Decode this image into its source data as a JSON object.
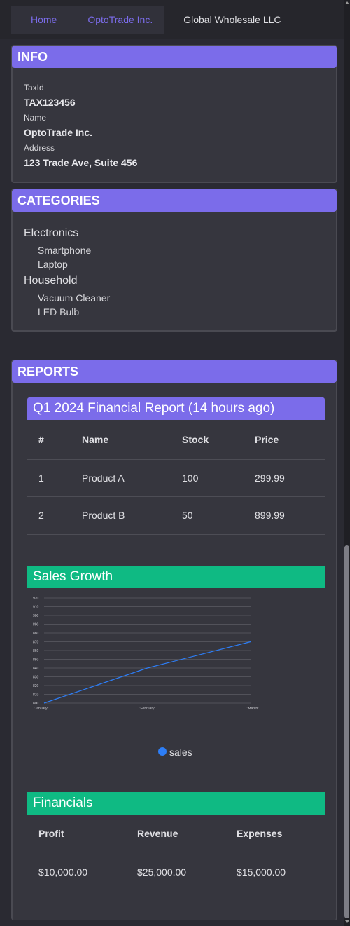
{
  "tabs": [
    "Home",
    "OptoTrade Inc.",
    "Global Wholesale LLC"
  ],
  "info": {
    "title": "INFO",
    "fields": [
      {
        "label": "TaxId",
        "value": "TAX123456"
      },
      {
        "label": "Name",
        "value": "OptoTrade Inc."
      },
      {
        "label": "Address",
        "value": "123 Trade Ave, Suite 456"
      }
    ]
  },
  "categories": {
    "title": "CATEGORIES",
    "groups": [
      {
        "name": "Electronics",
        "items": [
          "Smartphone",
          "Laptop"
        ]
      },
      {
        "name": "Household",
        "items": [
          "Vacuum Cleaner",
          "LED Bulb"
        ]
      }
    ]
  },
  "reports": {
    "title": "REPORTS",
    "financial_report": {
      "title": "Q1 2024 Financial Report (14 hours ago)",
      "columns": [
        "#",
        "Name",
        "Stock",
        "Price"
      ],
      "rows": [
        [
          "1",
          "Product A",
          "100",
          "299.99"
        ],
        [
          "2",
          "Product B",
          "50",
          "899.99"
        ]
      ]
    },
    "sales_growth": {
      "title": "Sales Growth",
      "legend": "sales"
    },
    "financials": {
      "title": "Financials",
      "columns": [
        "Profit",
        "Revenue",
        "Expenses"
      ],
      "values": [
        "$10,000.00",
        "$25,000.00",
        "$15,000.00"
      ]
    }
  },
  "chart_data": {
    "type": "line",
    "categories": [
      "\"January\"",
      "\"February\"",
      "\"March\""
    ],
    "series": [
      {
        "name": "sales",
        "values": [
          800,
          840,
          870
        ],
        "color": "#2d7ef7"
      }
    ],
    "yticks": [
      "800",
      "810",
      "820",
      "830",
      "840",
      "850",
      "860",
      "870",
      "880",
      "890",
      "900",
      "910",
      "920"
    ],
    "ylim": [
      800,
      920
    ],
    "title": "",
    "xlabel": "",
    "ylabel": "",
    "grid": true,
    "legend_placement": "bottom"
  },
  "colors": {
    "accent": "#7b6cea",
    "green": "#0fba83",
    "line": "#2d7ef7"
  }
}
